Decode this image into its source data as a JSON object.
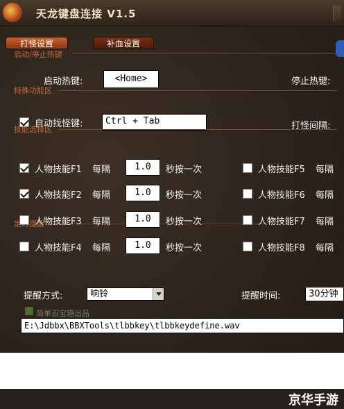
{
  "window": {
    "title": "天龙键盘连接 V1.5"
  },
  "tabs": [
    {
      "label": "打怪设置",
      "active": true
    },
    {
      "label": "补血设置",
      "active": false
    }
  ],
  "sections": {
    "hotkey": "启动/停止热键",
    "special": "特殊功能区",
    "skill": "技能选择区",
    "remind": "定时提醒"
  },
  "hotkeys": {
    "start_label": "启动热键:",
    "start_value": "<Home>",
    "stop_label": "停止热键:"
  },
  "auto_find": {
    "label": "自动找怪键:",
    "checked": true,
    "value": "Ctrl + Tab",
    "interval_label": "打怪间隔:"
  },
  "skills_left": [
    {
      "label": "人物技能F1",
      "checked": true,
      "every": "每隔",
      "value": "1.0",
      "suffix": "秒按一次"
    },
    {
      "label": "人物技能F2",
      "checked": true,
      "every": "每隔",
      "value": "1.0",
      "suffix": "秒按一次"
    },
    {
      "label": "人物技能F3",
      "checked": false,
      "every": "每隔",
      "value": "1.0",
      "suffix": "秒按一次"
    },
    {
      "label": "人物技能F4",
      "checked": false,
      "every": "每隔",
      "value": "1.0",
      "suffix": "秒按一次"
    }
  ],
  "skills_right": [
    {
      "label": "人物技能F5",
      "checked": false,
      "every": "每隔"
    },
    {
      "label": "人物技能F6",
      "checked": false,
      "every": "每隔"
    },
    {
      "label": "人物技能F7",
      "checked": false,
      "every": "每隔"
    },
    {
      "label": "人物技能F8",
      "checked": false,
      "every": "每隔"
    }
  ],
  "remind": {
    "mode_label": "提醒方式:",
    "mode_value": "响铃",
    "time_label": "提醒时间:",
    "time_value": "30分钟"
  },
  "watermark": "简单百宝箱出品",
  "wav_path": "E:\\Jdbbx\\BBXTools\\tlbbkey\\tlbbkeydefine.wav",
  "footer": {
    "brand": "京华手游"
  },
  "colors": {
    "accent": "#c2683a",
    "tab_active": "#c9622b",
    "background": "#2c231b"
  }
}
